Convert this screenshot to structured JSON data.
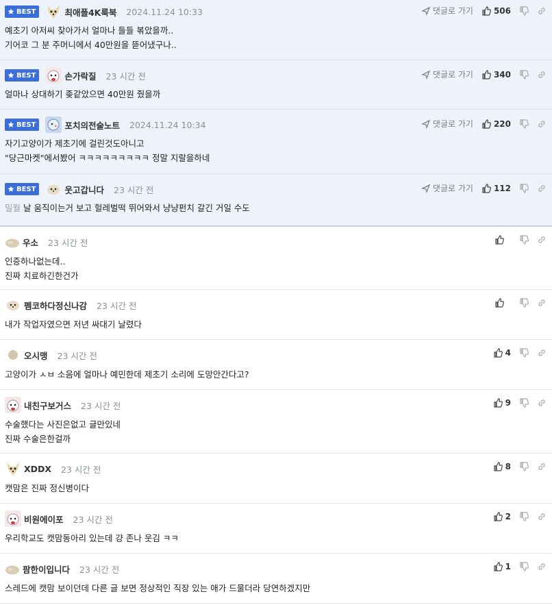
{
  "best_label": "BEST",
  "reply_go_label": "댓글로 가기",
  "comments": [
    {
      "nick": "최애플4K룩북",
      "time": "2024.11.24 10:33",
      "likes": "506",
      "lines": [
        "예초기 아저씨 찾아가서 얼마나 들들 볶았을까..",
        "기어코 그 분 주머니에서 40만원을 뜯어냈구나.."
      ]
    },
    {
      "nick": "손가락질",
      "time": "23 시간 전",
      "likes": "340",
      "lines": [
        "얼마나 상대하기 좆같았으면 40만원 줬을까"
      ]
    },
    {
      "nick": "포치의전술노트",
      "time": "2024.11.24 10:34",
      "likes": "220",
      "lines": [
        "자기고양이가 제초기에 걸린것도아니고",
        "\"당근마켓\"에서봤어 ㅋㅋㅋㅋㅋㅋㅋㅋㅋ 정말 지랄을하네"
      ]
    },
    {
      "nick": "웃고갑니다",
      "time": "23 시간 전",
      "likes": "112",
      "quote": "밀월",
      "lines": [
        "날 움직이는거 보고 헐레벌떡 뛰어와서 냥냥펀치 갈긴 거일 수도"
      ]
    },
    {
      "nick": "우소",
      "time": "23 시간 전",
      "likes": "",
      "lines": [
        "인증하나없는데..",
        "진짜 치료하긴한건가"
      ]
    },
    {
      "nick": "펨코하다정신나감",
      "time": "23 시간 전",
      "likes": "",
      "lines": [
        "내가 작업자였으면 저년 싸대기 날렸다"
      ]
    },
    {
      "nick": "오시맹",
      "time": "23 시간 전",
      "likes": "4",
      "lines": [
        "고양이가 ㅅㅂ 소음에 얼마나 예민한데 제초기 소리에 도망안간다고?"
      ]
    },
    {
      "nick": "내친구보거스",
      "time": "23 시간 전",
      "likes": "9",
      "lines": [
        "수술했다는 사진은없고 글만있네",
        "진짜 수술은한걸까"
      ]
    },
    {
      "nick": "XDDX",
      "time": "23 시간 전",
      "likes": "8",
      "lines": [
        "캣맘은 진짜 정신병이다"
      ]
    },
    {
      "nick": "비원에이포",
      "time": "23 시간 전",
      "likes": "2",
      "lines": [
        "우리학교도 캣맘동아리 있는데 걍 존나 웃김 ㅋㅋ"
      ]
    },
    {
      "nick": "팜한이입니다",
      "time": "23 시간 전",
      "likes": "1",
      "lines": [
        "스레드에 캣맘 보이던데 다른 글 보면 정상적인 직장 있는 애가 드물더라 당연하겠지만"
      ]
    }
  ],
  "colors": {
    "best_bg": "#eef2fa",
    "badge": "#3b6ed9"
  }
}
